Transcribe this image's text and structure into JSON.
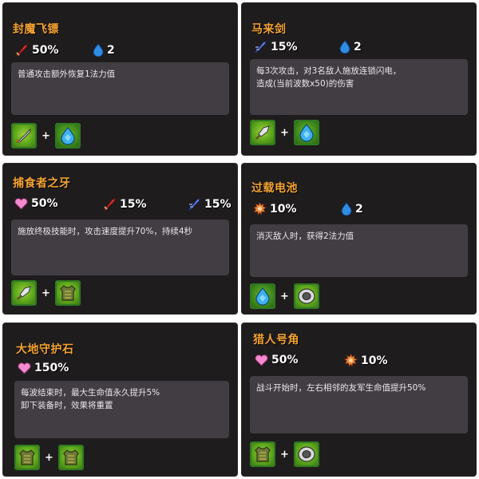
{
  "cards": [
    {
      "title": "封魔飞镖",
      "stats": [
        {
          "icon": "red-sword-icon",
          "value": "50%"
        },
        {
          "icon": "mana-drop-icon",
          "value": "2"
        }
      ],
      "desc": [
        "普通攻击额外恢复1法力值"
      ],
      "items": [
        "sword-item-icon",
        "blue-gem-item-icon"
      ]
    },
    {
      "title": "马来剑",
      "stats": [
        {
          "icon": "blue-sword-icon",
          "value": "15%"
        },
        {
          "icon": "mana-drop-icon",
          "value": "2"
        }
      ],
      "desc": [
        "每3次攻击，对3名敌人施放连锁闪电，",
        "造成(当前波数x50)的伤害"
      ],
      "items": [
        "spearhead-item-icon",
        "blue-gem-item-icon"
      ]
    },
    {
      "title": "捕食者之牙",
      "stats": [
        {
          "icon": "heart-icon",
          "value": "50%"
        },
        {
          "icon": "red-sword-icon",
          "value": "15%"
        },
        {
          "icon": "blue-sword-icon",
          "value": "15%"
        }
      ],
      "desc": [
        "施放终极技能时，攻击速度提升70%，持续4秒"
      ],
      "items": [
        "spearhead-item-icon",
        "armor-vest-item-icon"
      ]
    },
    {
      "title": "过载电池",
      "stats": [
        {
          "icon": "gear-burst-icon",
          "value": "10%"
        },
        {
          "icon": "mana-drop-icon",
          "value": "2"
        }
      ],
      "desc": [
        "消灭敌人时，获得2法力值"
      ],
      "items": [
        "blue-gem-item-icon",
        "steel-ring-item-icon"
      ]
    },
    {
      "title": "大地守护石",
      "stats": [
        {
          "icon": "heart-icon",
          "value": "150%"
        }
      ],
      "desc": [
        "每波结束时，最大生命值永久提升5%",
        "卸下装备时，效果将重置"
      ],
      "items": [
        "armor-vest-item-icon",
        "armor-vest-item-icon"
      ]
    },
    {
      "title": "猎人号角",
      "stats": [
        {
          "icon": "heart-icon",
          "value": "50%"
        },
        {
          "icon": "gear-burst-icon",
          "value": "10%"
        }
      ],
      "desc": [
        "战斗开始时，左右相邻的友军生命值提升50%"
      ],
      "items": [
        "armor-vest-item-icon",
        "steel-ring-item-icon"
      ]
    }
  ],
  "plus_sign": "+",
  "colors": {
    "panel": "#1f1c1d",
    "title": "#f6a532",
    "desc_bg": "#413d42",
    "item_border": "#2f7a22"
  }
}
